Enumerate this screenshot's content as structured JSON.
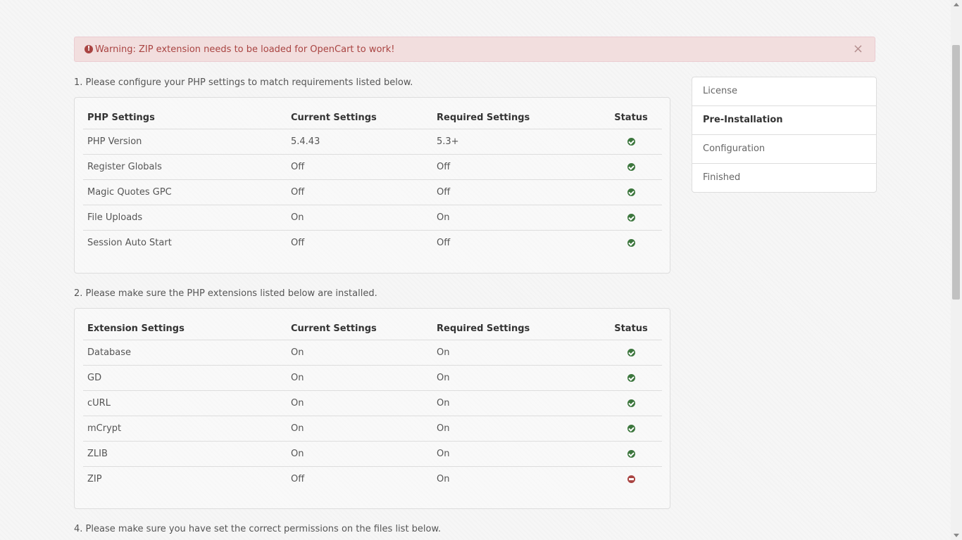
{
  "top_text": "",
  "alert": {
    "icon": "exclamation-circle-icon",
    "message": "Warning: ZIP extension needs to be loaded for OpenCart to work!",
    "close": "×"
  },
  "section1": {
    "title": "1. Please configure your PHP settings to match requirements listed below.",
    "headers": [
      "PHP Settings",
      "Current Settings",
      "Required Settings",
      "Status"
    ],
    "rows": [
      {
        "name": "PHP Version",
        "current": "5.4.43",
        "required": "5.3+",
        "status": "ok"
      },
      {
        "name": "Register Globals",
        "current": "Off",
        "required": "Off",
        "status": "ok"
      },
      {
        "name": "Magic Quotes GPC",
        "current": "Off",
        "required": "Off",
        "status": "ok"
      },
      {
        "name": "File Uploads",
        "current": "On",
        "required": "On",
        "status": "ok"
      },
      {
        "name": "Session Auto Start",
        "current": "Off",
        "required": "Off",
        "status": "ok"
      }
    ]
  },
  "section2": {
    "title": "2. Please make sure the PHP extensions listed below are installed.",
    "headers": [
      "Extension Settings",
      "Current Settings",
      "Required Settings",
      "Status"
    ],
    "rows": [
      {
        "name": "Database",
        "current": "On",
        "required": "On",
        "status": "ok"
      },
      {
        "name": "GD",
        "current": "On",
        "required": "On",
        "status": "ok"
      },
      {
        "name": "cURL",
        "current": "On",
        "required": "On",
        "status": "ok"
      },
      {
        "name": "mCrypt",
        "current": "On",
        "required": "On",
        "status": "ok"
      },
      {
        "name": "ZLIB",
        "current": "On",
        "required": "On",
        "status": "ok"
      },
      {
        "name": "ZIP",
        "current": "Off",
        "required": "On",
        "status": "error"
      }
    ]
  },
  "section4": {
    "title": "4. Please make sure you have set the correct permissions on the files list below."
  },
  "steps": {
    "items": [
      "License",
      "Pre-Installation",
      "Configuration",
      "Finished"
    ],
    "active": "Pre-Installation"
  },
  "colors": {
    "ok": "#3c763d",
    "error": "#a94442",
    "alert_bg": "#f2dede",
    "alert_text": "#a94442"
  }
}
